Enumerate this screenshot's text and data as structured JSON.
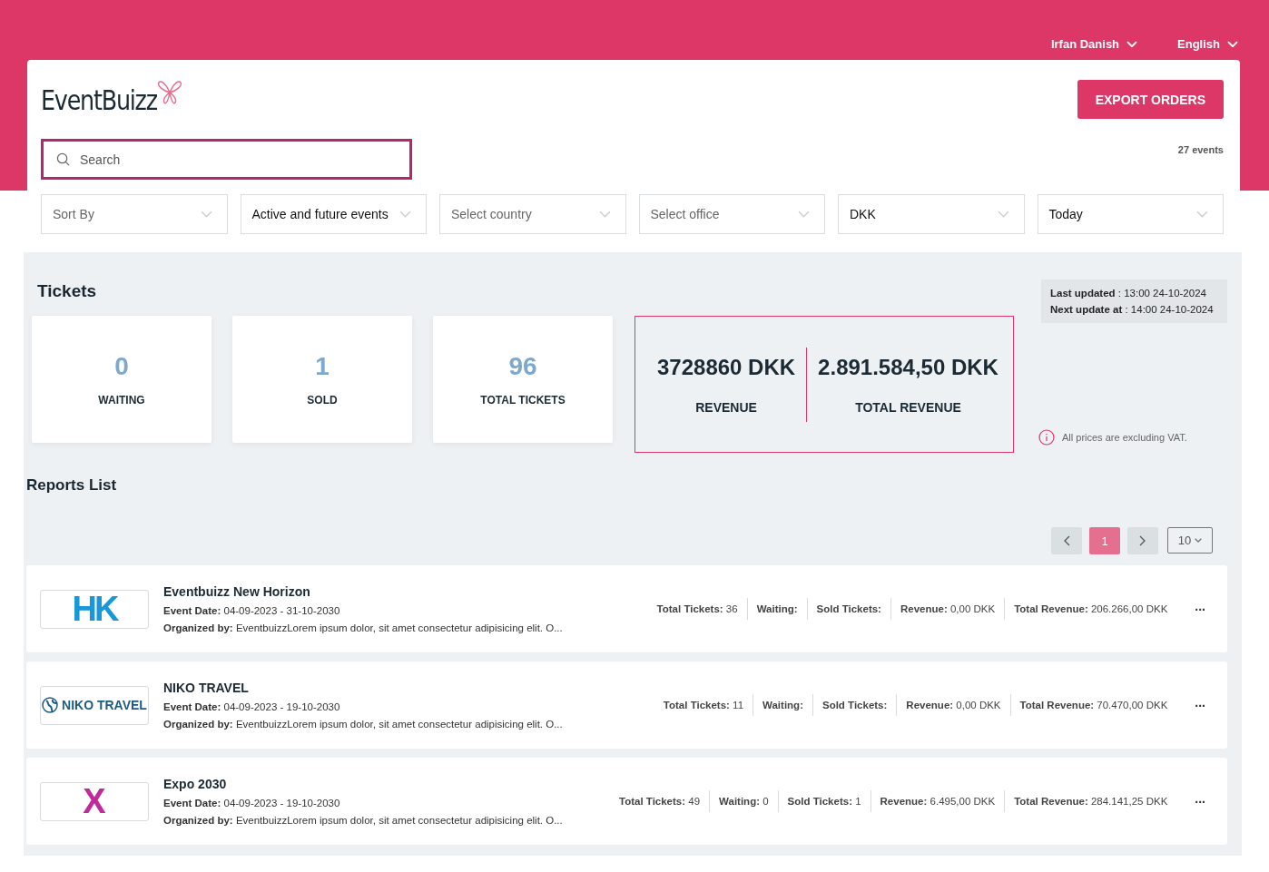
{
  "top_bar": {
    "user": "Irfan Danish",
    "language": "English"
  },
  "brand": {
    "name": "EventBuizz"
  },
  "export_button": "EXPORT ORDERS",
  "search": {
    "placeholder": "Search"
  },
  "event_count": "27 events",
  "filters": [
    {
      "placeholder": "Sort By"
    },
    {
      "value": "Active and future events"
    },
    {
      "placeholder": "Select country"
    },
    {
      "placeholder": "Select office"
    },
    {
      "value": "DKK"
    },
    {
      "value": "Today"
    }
  ],
  "tickets": {
    "title": "Tickets",
    "stats": [
      {
        "value": "0",
        "label": "WAITING"
      },
      {
        "value": "1",
        "label": "SOLD"
      },
      {
        "value": "96",
        "label": "TOTAL TICKETS"
      }
    ],
    "revenue": [
      {
        "value": "3728860 DKK",
        "label": "REVENUE"
      },
      {
        "value": "2.891.584,50 DKK",
        "label": "TOTAL REVENUE"
      }
    ],
    "updates": [
      "**Last updated** : 13:00 24-10-2024",
      "**Next update at** : 14:00 24-10-2024"
    ],
    "vat_note": "All prices are excluding VAT."
  },
  "reports": {
    "title": "Reports List",
    "pagination": {
      "pages": [
        {
          "label": "1",
          "selected": true
        }
      ],
      "page_size": "10"
    },
    "events": [
      {
        "logo": {
          "kind": "hk",
          "text": "HK"
        },
        "name": "Eventbuizz New Horizon",
        "date_label": "Event Date:",
        "date": "04-09-2023 - 31-10-2030",
        "organizer_label": "Organized by:",
        "organizer": "EventbuizzLorem ipsum dolor, sit amet consectetur adipisicing elit. O...",
        "stats": [
          {
            "label": "Total Tickets:",
            "value": "36"
          },
          {
            "label": "Waiting:"
          },
          {
            "label": "Sold Tickets:"
          },
          {
            "label": "Revenue:",
            "value": "0,00 DKK"
          },
          {
            "label": "Total Revenue:",
            "value": "206.266,00 DKK"
          }
        ],
        "more": "..."
      },
      {
        "logo": {
          "kind": "globe",
          "text": "NIKO TRAVEL"
        },
        "name": "NIKO TRAVEL",
        "date_label": "Event Date:",
        "date": "04-09-2023 - 19-10-2030",
        "organizer_label": "Organized by:",
        "organizer": "EventbuizzLorem ipsum dolor, sit amet consectetur adipisicing elit. O...",
        "stats": [
          {
            "label": "Total Tickets:",
            "value": "11"
          },
          {
            "label": "Waiting:"
          },
          {
            "label": "Sold Tickets:"
          },
          {
            "label": "Revenue:",
            "value": "0,00 DKK"
          },
          {
            "label": "Total Revenue:",
            "value": "70.470,00 DKK"
          }
        ],
        "more": "..."
      },
      {
        "logo": {
          "kind": "x",
          "text": "X"
        },
        "name": "Expo 2030",
        "date_label": "Event Date:",
        "date": "04-09-2023 - 19-10-2030",
        "organizer_label": "Organized by:",
        "organizer": "EventbuizzLorem ipsum dolor, sit amet consectetur adipisicing elit. O...",
        "stats": [
          {
            "label": "Total Tickets:",
            "value": "49"
          },
          {
            "label": "Waiting:",
            "value": "0"
          },
          {
            "label": "Sold Tickets:",
            "value": "1"
          },
          {
            "label": "Revenue:",
            "value": "6.495,00 DKK"
          },
          {
            "label": "Total Revenue:",
            "value": "284.141,25 DKK"
          }
        ],
        "more": "..."
      }
    ]
  }
}
